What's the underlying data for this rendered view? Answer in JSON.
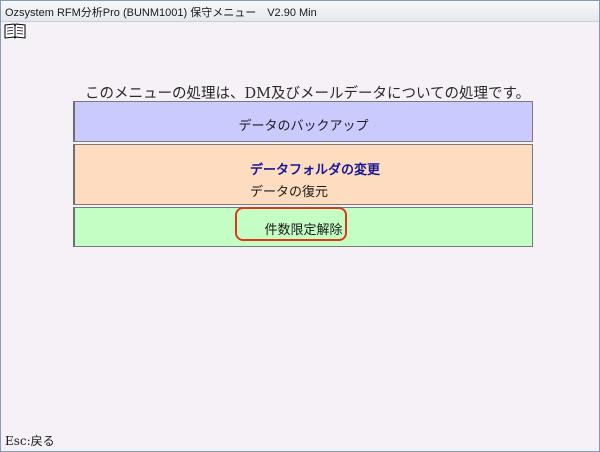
{
  "window": {
    "title": "Ozsystem RFM分析Pro (BUNM1001) 保守メニュー　V2.90 Min"
  },
  "toolbar": {
    "icon": "book-icon"
  },
  "message": "このメニューの処理は、DM及びメールデータについての処理です。",
  "menu": {
    "backup_label": "データのバックアップ",
    "change_folder_label": "データフォルダの変更",
    "restore_label": "データの復元",
    "limit_release_label": "件数限定解除"
  },
  "footer": {
    "esc_hint": "Esc:戻る"
  },
  "colors": {
    "backup_bg": "#cacaff",
    "restore_bg": "#fddcbf",
    "limit_bg": "#c4fec4",
    "highlight": "#d83a1a",
    "folder_change_text": "#16169a"
  }
}
